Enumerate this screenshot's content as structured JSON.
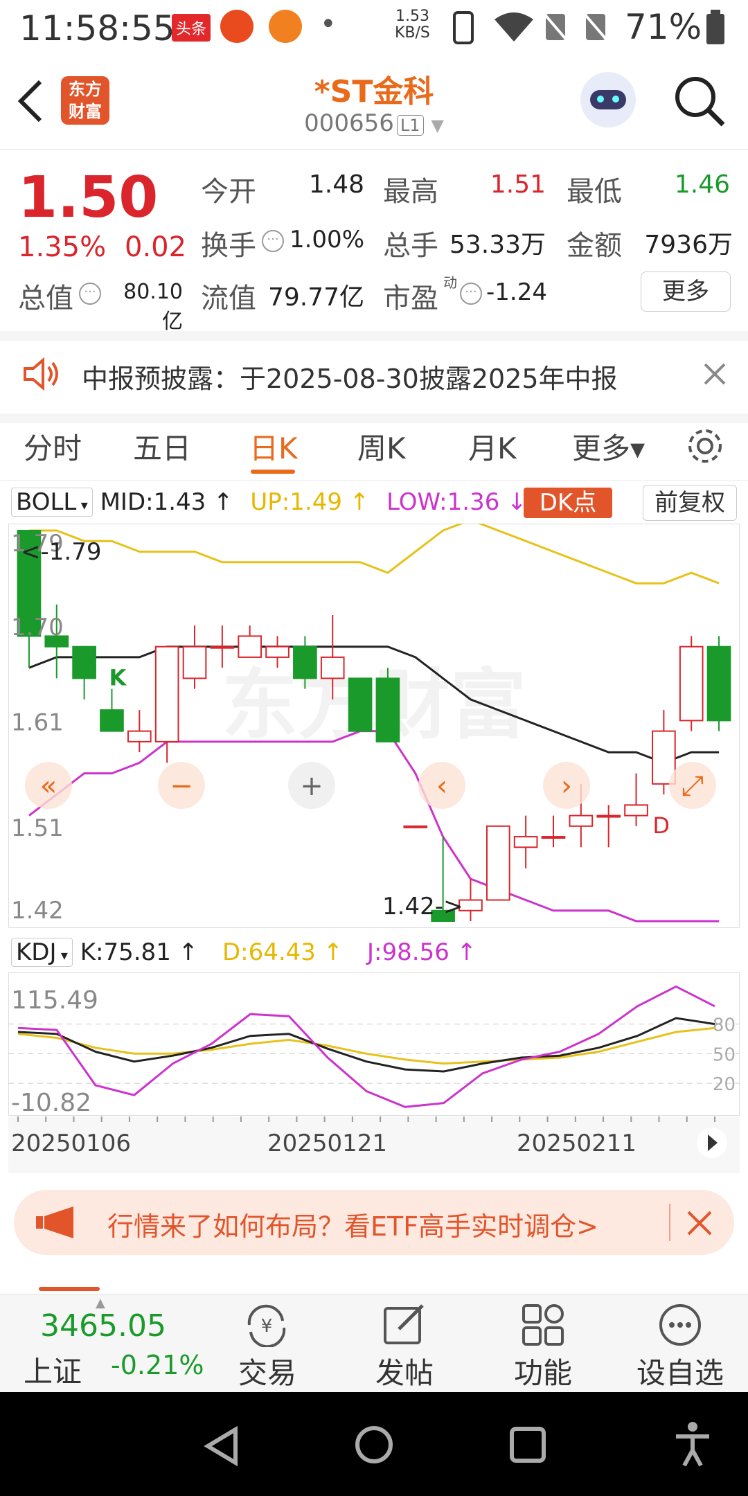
{
  "status_bar": {
    "time": "11:58:55",
    "net_speed_value": "1.53",
    "net_speed_unit": "KB/S",
    "battery": "71%",
    "app_badges": [
      "头条",
      "",
      "",
      "•"
    ]
  },
  "header": {
    "logo_text_1": "东方",
    "logo_text_2": "财富",
    "title": "*ST金科",
    "code": "000656",
    "level_badge": "L1"
  },
  "quote": {
    "price": "1.50",
    "change_pct": "1.35%",
    "change_amt": "0.02",
    "fields": {
      "open_label": "今开",
      "open": "1.48",
      "high_label": "最高",
      "high": "1.51",
      "low_label": "最低",
      "low": "1.46",
      "turnover_label": "换手",
      "turnover": "1.00%",
      "volume_label": "总手",
      "volume": "53.33万",
      "amount_label": "金额",
      "amount": "7936万",
      "mktcap_label": "总值",
      "mktcap": "80.10亿",
      "float_label": "流值",
      "float": "79.77亿",
      "pe_label": "市盈",
      "pe_sup": "动",
      "pe": "-1.24"
    },
    "more_label": "更多"
  },
  "notice": {
    "text": "中报预披露：于2025-08-30披露2025年中报"
  },
  "tabs": [
    {
      "label": "分时",
      "active": false
    },
    {
      "label": "五日",
      "active": false
    },
    {
      "label": "日K",
      "active": true
    },
    {
      "label": "周K",
      "active": false
    },
    {
      "label": "月K",
      "active": false
    },
    {
      "label": "更多▾",
      "active": false
    }
  ],
  "boll": {
    "name": "BOLL",
    "mid": "MID:1.43 ↑",
    "up": "UP:1.49 ↑",
    "low": "LOW:1.36 ↓",
    "dk_label": "DK点",
    "adjust_label": "前复权"
  },
  "kdj": {
    "name": "KDJ",
    "k": "K:75.81 ↑",
    "d": "D:64.43 ↑",
    "j": "J:98.56 ↑"
  },
  "chart_data": {
    "type": "candlestick",
    "price_axis_labels": [
      "1.79",
      "1.70",
      "1.61",
      "1.51",
      "1.42"
    ],
    "price_axis_values": [
      1.79,
      1.7,
      1.61,
      1.51,
      1.42
    ],
    "ylim": [
      1.42,
      1.79
    ],
    "annotations": [
      "<-1.79",
      "1.42->",
      "K",
      "D"
    ],
    "candles": [
      {
        "o": 1.79,
        "h": 1.79,
        "l": 1.66,
        "c": 1.69
      },
      {
        "o": 1.69,
        "h": 1.72,
        "l": 1.65,
        "c": 1.68
      },
      {
        "o": 1.68,
        "h": 1.68,
        "l": 1.63,
        "c": 1.65
      },
      {
        "o": 1.62,
        "h": 1.64,
        "l": 1.6,
        "c": 1.6
      },
      {
        "o": 1.59,
        "h": 1.62,
        "l": 1.58,
        "c": 1.6
      },
      {
        "o": 1.59,
        "h": 1.68,
        "l": 1.57,
        "c": 1.68
      },
      {
        "o": 1.65,
        "h": 1.7,
        "l": 1.64,
        "c": 1.68
      },
      {
        "o": 1.68,
        "h": 1.7,
        "l": 1.66,
        "c": 1.68
      },
      {
        "o": 1.67,
        "h": 1.7,
        "l": 1.67,
        "c": 1.69
      },
      {
        "o": 1.67,
        "h": 1.69,
        "l": 1.66,
        "c": 1.68
      },
      {
        "o": 1.68,
        "h": 1.69,
        "l": 1.64,
        "c": 1.65
      },
      {
        "o": 1.65,
        "h": 1.71,
        "l": 1.63,
        "c": 1.67
      },
      {
        "o": 1.65,
        "h": 1.65,
        "l": 1.6,
        "c": 1.6
      },
      {
        "o": 1.65,
        "h": 1.66,
        "l": 1.59,
        "c": 1.59
      },
      {
        "o": 1.51,
        "h": 1.51,
        "l": 1.51,
        "c": 1.51
      },
      {
        "o": 1.43,
        "h": 1.5,
        "l": 1.42,
        "c": 1.42
      },
      {
        "o": 1.43,
        "h": 1.46,
        "l": 1.42,
        "c": 1.44
      },
      {
        "o": 1.44,
        "h": 1.51,
        "l": 1.44,
        "c": 1.51
      },
      {
        "o": 1.49,
        "h": 1.52,
        "l": 1.47,
        "c": 1.5
      },
      {
        "o": 1.5,
        "h": 1.52,
        "l": 1.49,
        "c": 1.5
      },
      {
        "o": 1.51,
        "h": 1.55,
        "l": 1.49,
        "c": 1.52
      },
      {
        "o": 1.52,
        "h": 1.53,
        "l": 1.49,
        "c": 1.52
      },
      {
        "o": 1.52,
        "h": 1.56,
        "l": 1.51,
        "c": 1.53
      },
      {
        "o": 1.55,
        "h": 1.62,
        "l": 1.54,
        "c": 1.6
      },
      {
        "o": 1.61,
        "h": 1.69,
        "l": 1.6,
        "c": 1.68
      },
      {
        "o": 1.68,
        "h": 1.69,
        "l": 1.6,
        "c": 1.61
      }
    ],
    "mid": [
      1.66,
      1.67,
      1.67,
      1.67,
      1.67,
      1.68,
      1.68,
      1.68,
      1.68,
      1.68,
      1.68,
      1.68,
      1.68,
      1.68,
      1.67,
      1.65,
      1.63,
      1.62,
      1.61,
      1.6,
      1.59,
      1.58,
      1.58,
      1.57,
      1.58,
      1.58
    ],
    "upper": [
      1.79,
      1.79,
      1.78,
      1.78,
      1.77,
      1.77,
      1.77,
      1.76,
      1.76,
      1.76,
      1.76,
      1.76,
      1.76,
      1.75,
      1.77,
      1.79,
      1.8,
      1.79,
      1.78,
      1.77,
      1.76,
      1.75,
      1.74,
      1.74,
      1.75,
      1.74
    ],
    "lower": [
      1.52,
      1.54,
      1.56,
      1.56,
      1.57,
      1.59,
      1.59,
      1.59,
      1.59,
      1.59,
      1.59,
      1.59,
      1.6,
      1.6,
      1.56,
      1.5,
      1.46,
      1.45,
      1.44,
      1.43,
      1.43,
      1.43,
      1.42,
      1.42,
      1.42,
      1.42
    ],
    "kdj_axis_labels": [
      "115.49",
      "-10.82"
    ],
    "kdj_ylim": [
      -10.82,
      115.49
    ],
    "kdj_right_ticks": [
      80,
      50,
      20
    ],
    "kdj_k": [
      72,
      70,
      52,
      42,
      48,
      56,
      68,
      70,
      55,
      42,
      34,
      32,
      40,
      46,
      48,
      56,
      68,
      86,
      80
    ],
    "kdj_d": [
      70,
      66,
      56,
      50,
      50,
      54,
      60,
      64,
      58,
      50,
      44,
      40,
      42,
      44,
      46,
      52,
      62,
      72,
      76
    ],
    "kdj_j": [
      76,
      74,
      18,
      8,
      40,
      60,
      90,
      88,
      46,
      12,
      -4,
      0,
      30,
      44,
      52,
      70,
      98,
      118,
      98
    ],
    "x_labels": [
      "20250106",
      "20250121",
      "20250211"
    ]
  },
  "banner": {
    "text": "行情来了如何布局？看ETF高手实时调仓>"
  },
  "bottom_bar": {
    "index_value": "3465.05",
    "index_name": "上证",
    "index_change": "-0.21%",
    "items": [
      "交易",
      "发帖",
      "功能",
      "设自选"
    ]
  }
}
